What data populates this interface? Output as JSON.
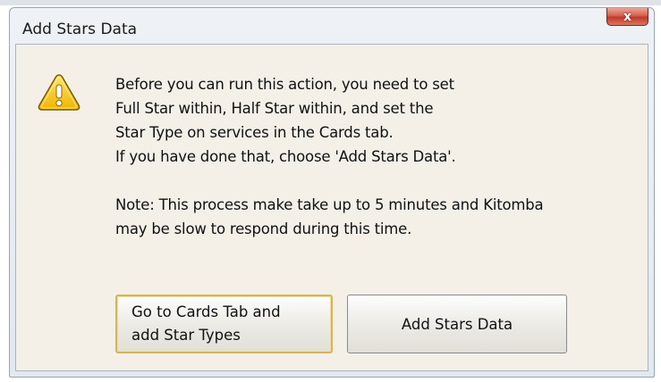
{
  "window": {
    "title": "Add Stars Data",
    "close_label": "x"
  },
  "message": {
    "lines": [
      "Before you can run this action, you need to set",
      "Full Star within, Half Star within, and set the",
      "Star Type on services in the Cards tab.",
      "If you have done that, choose 'Add Stars Data'."
    ],
    "note_lines": [
      "Note: This process make take up to 5 minutes and Kitomba",
      "may be slow to respond during this time."
    ]
  },
  "buttons": {
    "goto_label": "Go to Cards Tab and\nadd Star Types",
    "add_label": "Add Stars Data"
  },
  "icons": {
    "warning": "warning-icon",
    "close": "close-icon"
  },
  "colors": {
    "close_button": "#c0392b",
    "warning_fill": "#f2c200",
    "focused_button_border": "#d4b45a"
  }
}
